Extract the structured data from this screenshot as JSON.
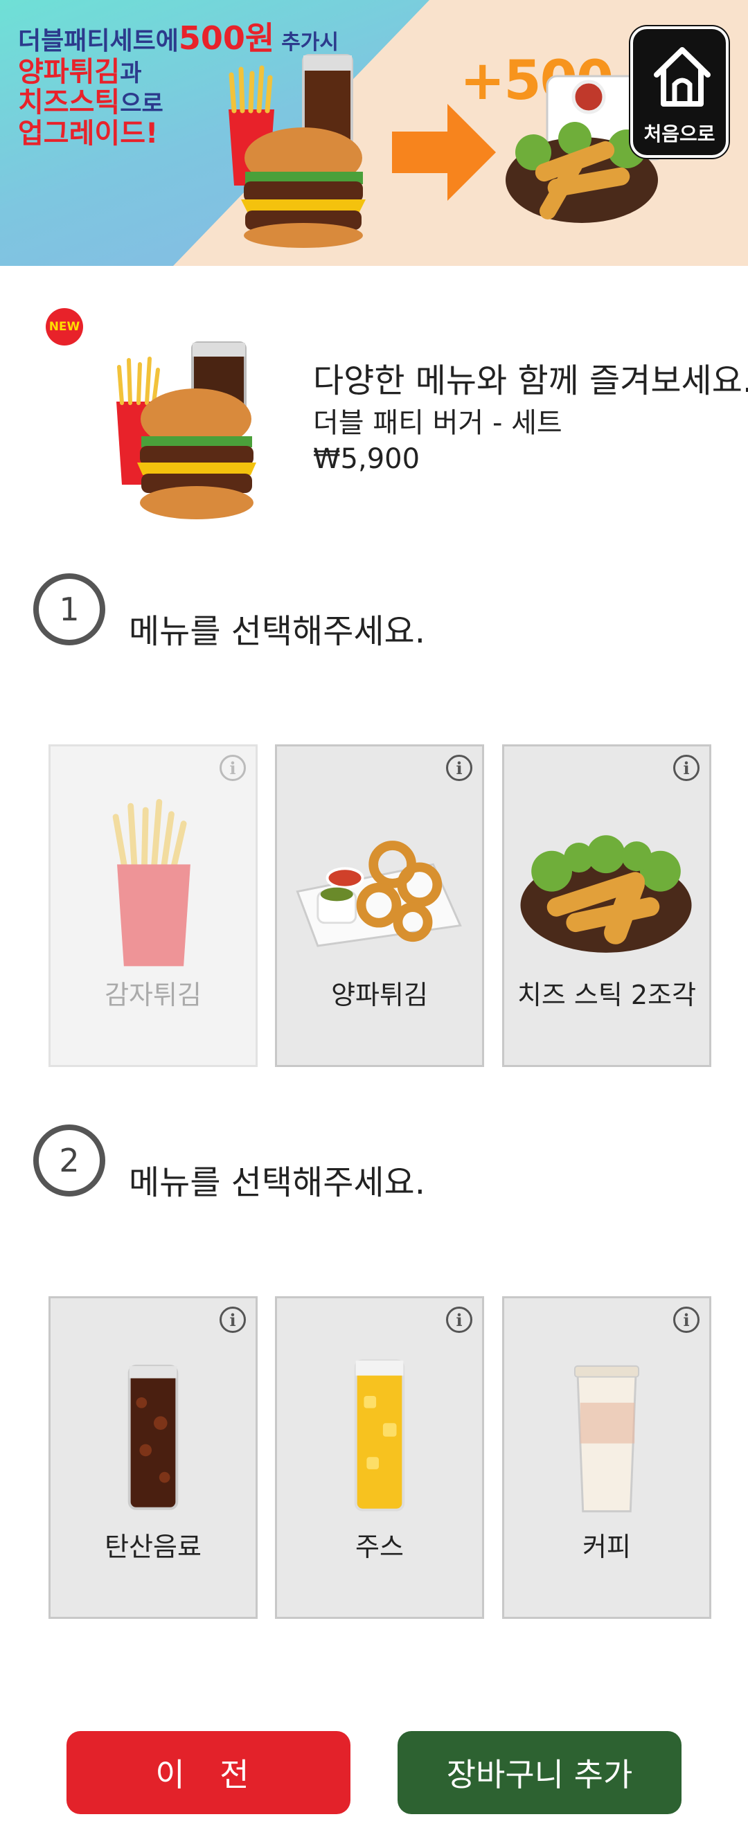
{
  "banner": {
    "line1_a": "더블패티세트에",
    "line1_price": "500원",
    "line1_b": "추가시",
    "line2_a": "양파튀김",
    "line2_b": "과",
    "line3_a": "치즈스틱",
    "line3_b": "으로",
    "line4": "업그레이드!",
    "plus": "+500"
  },
  "home_button": {
    "label": "처음으로",
    "icon": "home-icon"
  },
  "product": {
    "badge": "NEW",
    "tagline": "다양한 메뉴와 함께 즐겨보세요.",
    "name": "더블 패티 버거 - 세트",
    "price": "₩5,900"
  },
  "step1": {
    "number": "1",
    "title": "메뉴를 선택해주세요.",
    "options": [
      {
        "label": "감자튀김",
        "icon": "french-fries",
        "disabled": true
      },
      {
        "label": "양파튀김",
        "icon": "onion-rings",
        "disabled": false
      },
      {
        "label": "치즈 스틱 2조각",
        "icon": "cheese-sticks",
        "disabled": false
      }
    ]
  },
  "step2": {
    "number": "2",
    "title": "메뉴를 선택해주세요.",
    "options": [
      {
        "label": "탄산음료",
        "icon": "cola-glass",
        "disabled": false
      },
      {
        "label": "주스",
        "icon": "juice-glass",
        "disabled": false
      },
      {
        "label": "커피",
        "icon": "coffee-cup",
        "disabled": false
      }
    ]
  },
  "info_symbol": "i",
  "buttons": {
    "prev": "이 전",
    "add_cart": "장바구니 추가"
  },
  "colors": {
    "red": "#e3222a",
    "green": "#2d6231",
    "orange": "#f7941d"
  }
}
